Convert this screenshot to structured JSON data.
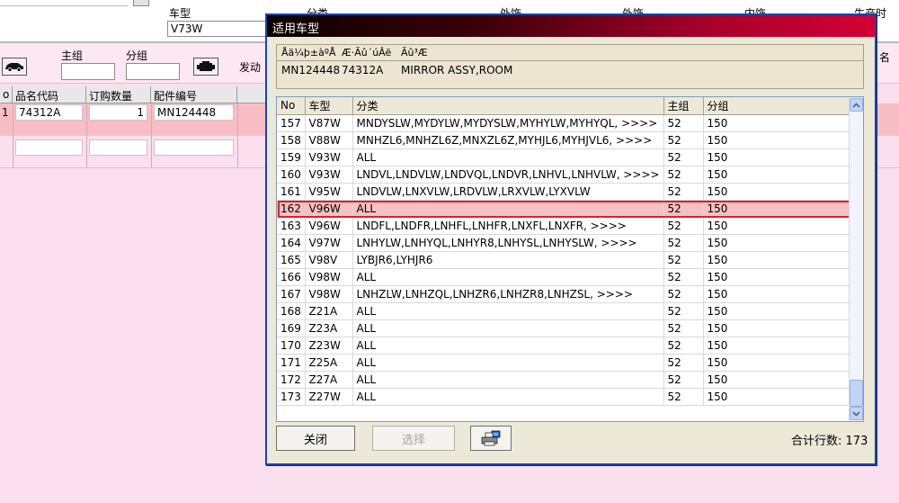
{
  "background": {
    "labels": {
      "model": "车型",
      "category": "分类",
      "exterior": "外饰",
      "interior": "内饰",
      "production": "生产时",
      "main_group": "主组",
      "sub_group": "分组",
      "engine": "发动",
      "right_edge": "名"
    },
    "model_value": "V73W",
    "grid": {
      "headers": [
        "o",
        "品名代码",
        "订购数量",
        "配件编号"
      ],
      "row": {
        "index": "1",
        "part_code": "74312A",
        "qty": "1",
        "part_no": "MN124448"
      }
    }
  },
  "dialog": {
    "title": "适用车型",
    "info": {
      "headers": [
        "Åä¼þ±àºÅ",
        "Æ·Ãû´úÂë",
        "Ãû³Æ"
      ],
      "values": [
        "MN124448",
        "74312A",
        "MIRROR ASSY,ROOM"
      ]
    },
    "table": {
      "columns": [
        "No",
        "车型",
        "分类",
        "主组",
        "分组"
      ],
      "rows": [
        {
          "no": "157",
          "model": "V87W",
          "category": "MNDYSLW,MYDYLW,MYDYSLW,MYHYLW,MYHYQL,  >>>>",
          "main": "52",
          "sub": "150"
        },
        {
          "no": "158",
          "model": "V88W",
          "category": "MNHZL6,MNHZL6Z,MNXZL6Z,MYHJL6,MYHJVL6,  >>>>",
          "main": "52",
          "sub": "150"
        },
        {
          "no": "159",
          "model": "V93W",
          "category": "ALL",
          "main": "52",
          "sub": "150"
        },
        {
          "no": "160",
          "model": "V93W",
          "category": "LNDVL,LNDVLW,LNDVQL,LNDVR,LNHVL,LNHVLW,  >>>>",
          "main": "52",
          "sub": "150"
        },
        {
          "no": "161",
          "model": "V95W",
          "category": "LNDVLW,LNXVLW,LRDVLW,LRXVLW,LYXVLW",
          "main": "52",
          "sub": "150"
        },
        {
          "no": "162",
          "model": "V96W",
          "category": "ALL",
          "main": "52",
          "sub": "150"
        },
        {
          "no": "163",
          "model": "V96W",
          "category": "LNDFL,LNDFR,LNHFL,LNHFR,LNXFL,LNXFR,  >>>>",
          "main": "52",
          "sub": "150"
        },
        {
          "no": "164",
          "model": "V97W",
          "category": "LNHYLW,LNHYQL,LNHYR8,LNHYSL,LNHYSLW,  >>>>",
          "main": "52",
          "sub": "150"
        },
        {
          "no": "165",
          "model": "V98V",
          "category": "LYBJR6,LYHJR6",
          "main": "52",
          "sub": "150"
        },
        {
          "no": "166",
          "model": "V98W",
          "category": "ALL",
          "main": "52",
          "sub": "150"
        },
        {
          "no": "167",
          "model": "V98W",
          "category": "LNHZLW,LNHZQL,LNHZR6,LNHZR8,LNHZSL,  >>>>",
          "main": "52",
          "sub": "150"
        },
        {
          "no": "168",
          "model": "Z21A",
          "category": "ALL",
          "main": "52",
          "sub": "150"
        },
        {
          "no": "169",
          "model": "Z23A",
          "category": "ALL",
          "main": "52",
          "sub": "150"
        },
        {
          "no": "170",
          "model": "Z23W",
          "category": "ALL",
          "main": "52",
          "sub": "150"
        },
        {
          "no": "171",
          "model": "Z25A",
          "category": "ALL",
          "main": "52",
          "sub": "150"
        },
        {
          "no": "172",
          "model": "Z27A",
          "category": "ALL",
          "main": "52",
          "sub": "150"
        },
        {
          "no": "173",
          "model": "Z27W",
          "category": "ALL",
          "main": "52",
          "sub": "150"
        }
      ],
      "selected_no": "162"
    },
    "buttons": {
      "close": "关闭",
      "select": "选择"
    },
    "count_label": "合计行数:",
    "count_value": "173"
  },
  "icons": [
    "car-icon",
    "engine-icon",
    "printer-icon",
    "scroll-up-icon",
    "scroll-down-icon"
  ],
  "colors": {
    "background": "#fbdfee",
    "selected_row": "#f3c1c6",
    "selection_outline": "#e0201e",
    "dialog_border": "#1d43a8",
    "title_gradient_end": "#d40034"
  }
}
